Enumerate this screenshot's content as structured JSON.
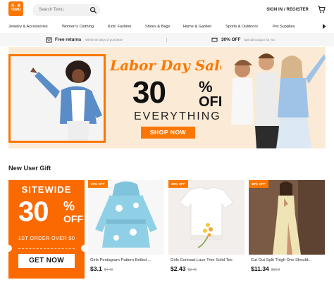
{
  "brand": {
    "logo_line1": "兆 • 顺",
    "logo_line2": "TEMU",
    "color": "#fb7701"
  },
  "search": {
    "placeholder": "Search Temu",
    "icon": "search-icon"
  },
  "header": {
    "signin_label": "SIGN IN / REGISTER",
    "cart_icon": "cart-icon"
  },
  "nav": {
    "items": [
      "Jewelry & Accessories",
      "Women's Clothing",
      "Kids' Fashion",
      "Shoes & Bags",
      "Home & Garden",
      "Sports & Outdoors",
      "Pet Supplies"
    ],
    "next_icon": "chevron-right-icon"
  },
  "infobar": {
    "free_returns": {
      "title": "Free returns",
      "sub": "Within 90 days of purchase",
      "icon": "return-box-icon"
    },
    "discount": {
      "title": "30% OFF",
      "sub": "Special coupon for you",
      "icon": "coupon-icon"
    }
  },
  "banner": {
    "title": "Labor Day Sale",
    "percent": "30",
    "percent_sign": "%",
    "off": "OFF",
    "everything": "EVERYTHING",
    "cta": "SHOP NOW"
  },
  "gift": {
    "title": "New User Gift",
    "coupon": {
      "sitewide": "SITEWIDE",
      "percent": "30",
      "percent_sign": "%",
      "off": "OFF",
      "order": "1ST ORDER OVER $0",
      "cta": "GET NOW"
    },
    "products": [
      {
        "badge": "30% OFF",
        "name": "Girls Pentagram Pattern Belted ...",
        "price": "$3.1",
        "old_price": "$4.42"
      },
      {
        "badge": "30% OFF",
        "name": "Girls Contrast Lace Trim Solid Tee",
        "price": "$2.43",
        "old_price": "$3.46"
      },
      {
        "badge": "30% OFF",
        "name": "Cut Out Split Thigh One Should...",
        "price": "$11.34",
        "old_price": "$16.2"
      }
    ]
  }
}
